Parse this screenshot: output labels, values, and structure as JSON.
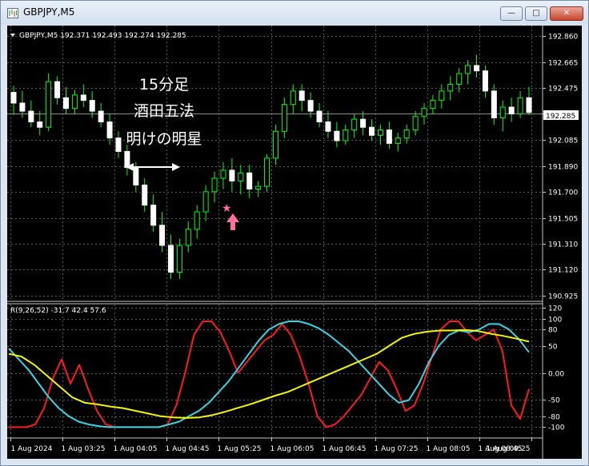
{
  "window": {
    "title": "GBPJPY,M5",
    "min_glyph": "—",
    "max_glyph": "□",
    "close_glyph": "✕"
  },
  "price_panel": {
    "header": "GBPJPY,M5  192.371 192.493 192.274 192.285",
    "current_price": "192.285",
    "price_labels": [
      "192.860",
      "192.665",
      "192.475",
      "192.280",
      "192.085",
      "191.890",
      "191.700",
      "191.505",
      "191.310",
      "191.120",
      "190.925"
    ]
  },
  "annotation": {
    "line1": "15分足",
    "line2": "酒田五法",
    "line3": "明けの明星",
    "star": "★"
  },
  "indicator": {
    "header": "R(9,26,52) -31.7 42.4 57.6",
    "levels": [
      "120",
      "100",
      "80",
      "50",
      "0.00",
      "-50",
      "-80",
      "-100"
    ]
  },
  "time_labels": [
    "1 Aug 2024",
    "1 Aug 03:25",
    "1 Aug 04:05",
    "1 Aug 04:45",
    "1 Aug 05:25",
    "1 Aug 06:05",
    "1 Aug 06:45",
    "1 Aug 07:25",
    "1 Aug 08:05",
    "1 Aug 08:45",
    "1 Aug 09:25"
  ],
  "chart_data": [
    {
      "type": "candlestick",
      "symbol": "GBPJPY",
      "timeframe": "M5",
      "ylim": [
        190.925,
        192.86
      ],
      "current": 192.285,
      "grid": true,
      "candles": [
        [
          192.44,
          192.49,
          192.27,
          192.36
        ],
        [
          192.36,
          192.45,
          192.25,
          192.3
        ],
        [
          192.3,
          192.38,
          192.18,
          192.22
        ],
        [
          192.22,
          192.3,
          192.12,
          192.18
        ],
        [
          192.18,
          192.58,
          192.15,
          192.52
        ],
        [
          192.52,
          192.56,
          192.35,
          192.4
        ],
        [
          192.4,
          192.48,
          192.28,
          192.32
        ],
        [
          192.32,
          192.46,
          192.28,
          192.42
        ],
        [
          192.42,
          192.5,
          192.33,
          192.38
        ],
        [
          192.38,
          192.45,
          192.25,
          192.3
        ],
        [
          192.3,
          192.36,
          192.18,
          192.22
        ],
        [
          192.22,
          192.28,
          192.05,
          192.1
        ],
        [
          192.1,
          192.15,
          191.95,
          192.0
        ],
        [
          192.0,
          192.05,
          191.82,
          191.88
        ],
        [
          191.88,
          191.92,
          191.7,
          191.75
        ],
        [
          191.75,
          191.8,
          191.55,
          191.6
        ],
        [
          191.6,
          191.68,
          191.4,
          191.45
        ],
        [
          191.45,
          191.55,
          191.25,
          191.3
        ],
        [
          191.3,
          191.38,
          191.05,
          191.1
        ],
        [
          191.1,
          191.35,
          191.05,
          191.3
        ],
        [
          191.3,
          191.48,
          191.25,
          191.42
        ],
        [
          191.42,
          191.6,
          191.35,
          191.55
        ],
        [
          191.55,
          191.75,
          191.48,
          191.7
        ],
        [
          191.7,
          191.85,
          191.62,
          191.8
        ],
        [
          191.8,
          191.92,
          191.72,
          191.86
        ],
        [
          191.86,
          191.95,
          191.7,
          191.78
        ],
        [
          191.78,
          191.9,
          191.68,
          191.84
        ],
        [
          191.84,
          191.9,
          191.65,
          191.72
        ],
        [
          191.72,
          191.78,
          191.66,
          191.74
        ],
        [
          191.74,
          191.98,
          191.7,
          191.95
        ],
        [
          191.95,
          192.2,
          191.9,
          192.15
        ],
        [
          192.15,
          192.4,
          192.1,
          192.35
        ],
        [
          192.35,
          192.5,
          192.28,
          192.45
        ],
        [
          192.45,
          192.5,
          192.3,
          192.38
        ],
        [
          192.38,
          192.44,
          192.25,
          192.3
        ],
        [
          192.3,
          192.36,
          192.18,
          192.22
        ],
        [
          192.22,
          192.3,
          192.1,
          192.15
        ],
        [
          192.15,
          192.22,
          192.03,
          192.08
        ],
        [
          192.08,
          192.2,
          192.05,
          192.16
        ],
        [
          192.16,
          192.28,
          192.1,
          192.24
        ],
        [
          192.24,
          192.3,
          192.12,
          192.18
        ],
        [
          192.18,
          192.24,
          192.08,
          192.12
        ],
        [
          192.12,
          192.2,
          192.05,
          192.16
        ],
        [
          192.16,
          192.22,
          192.02,
          192.06
        ],
        [
          192.06,
          192.14,
          192.0,
          192.1
        ],
        [
          192.1,
          192.2,
          192.06,
          192.16
        ],
        [
          192.16,
          192.3,
          192.12,
          192.26
        ],
        [
          192.26,
          192.36,
          192.2,
          192.32
        ],
        [
          192.32,
          192.42,
          192.28,
          192.38
        ],
        [
          192.38,
          192.5,
          192.32,
          192.45
        ],
        [
          192.45,
          192.56,
          192.38,
          192.5
        ],
        [
          192.5,
          192.62,
          192.44,
          192.58
        ],
        [
          192.58,
          192.68,
          192.5,
          192.64
        ],
        [
          192.64,
          192.72,
          192.55,
          192.6
        ],
        [
          192.6,
          192.64,
          192.4,
          192.45
        ],
        [
          192.45,
          192.5,
          192.2,
          192.25
        ],
        [
          192.25,
          192.38,
          192.15,
          192.33
        ],
        [
          192.33,
          192.4,
          192.22,
          192.28
        ],
        [
          192.28,
          192.45,
          192.25,
          192.4
        ],
        [
          192.4,
          192.48,
          192.27,
          192.29
        ]
      ]
    },
    {
      "type": "line",
      "name": "R(9,26,52)",
      "ylim": [
        -120,
        120
      ],
      "levels": [
        120,
        100,
        80,
        50,
        0,
        -50,
        -80,
        -100
      ],
      "latest": [
        -31.7,
        42.4,
        57.6
      ],
      "series": [
        {
          "color": "#ff1a1a",
          "values": [
            -100,
            -100,
            -100,
            -95,
            -65,
            -10,
            25,
            -20,
            15,
            -30,
            -70,
            -95,
            -100,
            -100,
            -100,
            -100,
            -100,
            -100,
            -95,
            -60,
            0,
            70,
            95,
            95,
            75,
            40,
            0,
            20,
            40,
            60,
            70,
            90,
            70,
            30,
            -20,
            -80,
            -100,
            -95,
            -80,
            -60,
            -40,
            -10,
            20,
            5,
            -30,
            -70,
            -60,
            -20,
            30,
            80,
            95,
            95,
            75,
            60,
            70,
            80,
            40,
            -60,
            -85,
            -30
          ]
        },
        {
          "color": "#33d6e6",
          "values": [
            45,
            25,
            5,
            -20,
            -45,
            -65,
            -80,
            -90,
            -95,
            -98,
            -100,
            -100,
            -100,
            -100,
            -100,
            -100,
            -95,
            -90,
            -80,
            -70,
            -55,
            -35,
            -15,
            10,
            35,
            60,
            80,
            90,
            95,
            95,
            90,
            82,
            70,
            55,
            40,
            20,
            0,
            -20,
            -40,
            -55,
            -50,
            -20,
            20,
            50,
            70,
            78,
            75,
            80,
            90,
            90,
            80,
            62,
            38
          ]
        },
        {
          "color": "#f5f500",
          "values": [
            35,
            30,
            15,
            -5,
            -25,
            -45,
            -55,
            -58,
            -62,
            -65,
            -70,
            -75,
            -80,
            -82,
            -83,
            -82,
            -78,
            -72,
            -65,
            -58,
            -50,
            -42,
            -35,
            -25,
            -15,
            -5,
            5,
            15,
            25,
            35,
            50,
            65,
            72,
            76,
            78,
            78,
            79,
            77,
            72,
            68,
            63,
            57.6
          ]
        }
      ]
    }
  ]
}
